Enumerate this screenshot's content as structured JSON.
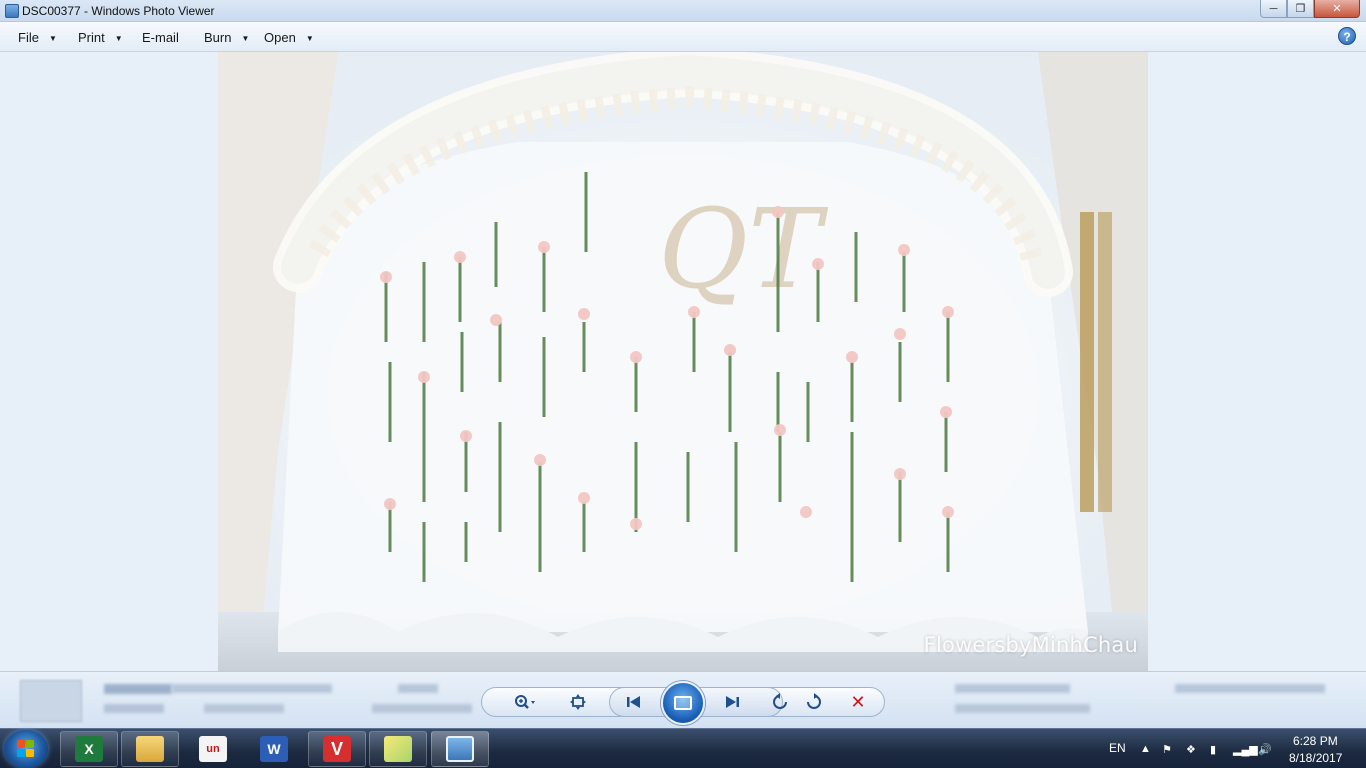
{
  "window": {
    "title": "DSC00377 - Windows Photo Viewer"
  },
  "menu": {
    "items": [
      {
        "label": "File",
        "has_dropdown": true
      },
      {
        "label": "Print",
        "has_dropdown": true
      },
      {
        "label": "E-mail",
        "has_dropdown": false
      },
      {
        "label": "Burn",
        "has_dropdown": true
      },
      {
        "label": "Open",
        "has_dropdown": true
      }
    ],
    "help_label": "?"
  },
  "photo": {
    "watermark": "FlowersbyMinhChau",
    "monogram": "QT"
  },
  "controls": {
    "zoom": "zoom-icon",
    "fit": "actual-size-icon",
    "previous": "previous-icon",
    "slideshow": "slideshow-icon",
    "next": "next-icon",
    "rotate_ccw": "rotate-counterclockwise-icon",
    "rotate_cw": "rotate-clockwise-icon",
    "delete": "delete-icon",
    "delete_color": "#d01818"
  },
  "taskbar": {
    "apps": [
      "excel-icon",
      "file-explorer-icon",
      "unikey-icon",
      "word-icon",
      "vivaldi-icon",
      "sticky-notes-icon",
      "photo-viewer-icon"
    ],
    "language": "EN",
    "time": "6:28 PM",
    "date": "8/18/2017"
  },
  "colors": {
    "accent": "#1f5fae",
    "taskbar": "#1c2a40"
  }
}
